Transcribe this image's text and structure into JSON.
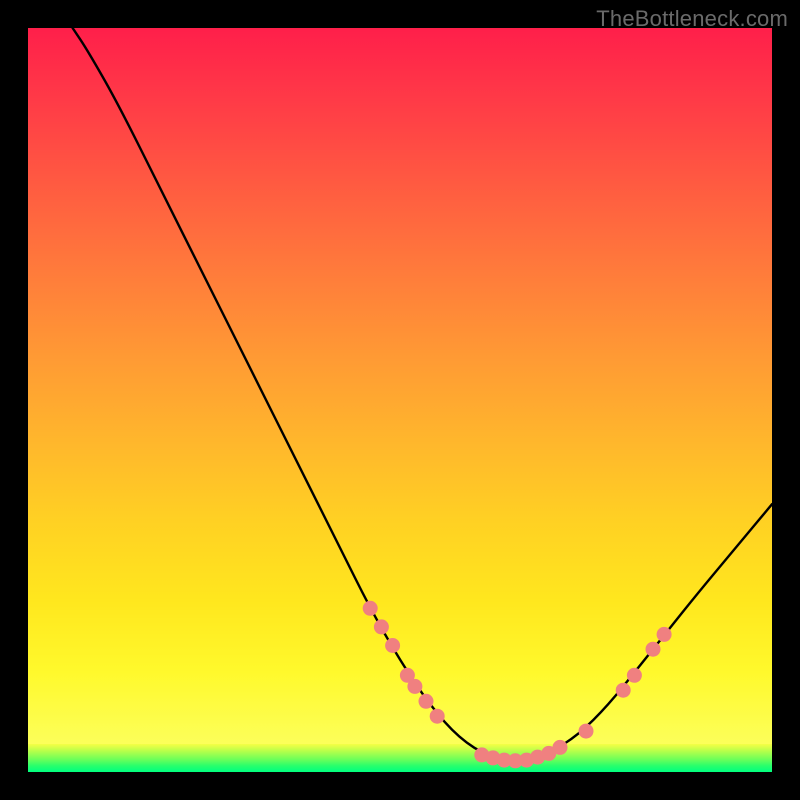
{
  "attribution": "TheBottleneck.com",
  "colors": {
    "point": "#f08080",
    "curve": "#000000",
    "gradient_top": "#ff1f4a",
    "gradient_mid": "#ffd123",
    "gradient_green": "#00ff80"
  },
  "chart_data": {
    "type": "line",
    "title": "",
    "xlabel": "",
    "ylabel": "",
    "xlim": [
      0,
      100
    ],
    "ylim": [
      0,
      100
    ],
    "grid": false,
    "legend": false,
    "note": "No axis tick labels are visible in the image; x and y are normalized 0–100 across the plot area. The black curve descends steeply from the top-left, bottoms out near x≈66, and rises toward the right edge. Salmon dots mark sampled points on the curve, clustered around the minimum.",
    "curve": [
      {
        "x": 6,
        "y": 100
      },
      {
        "x": 8,
        "y": 97
      },
      {
        "x": 12,
        "y": 90
      },
      {
        "x": 18,
        "y": 78
      },
      {
        "x": 24,
        "y": 66
      },
      {
        "x": 30,
        "y": 54
      },
      {
        "x": 36,
        "y": 42
      },
      {
        "x": 42,
        "y": 30
      },
      {
        "x": 46,
        "y": 22
      },
      {
        "x": 50,
        "y": 15
      },
      {
        "x": 54,
        "y": 9
      },
      {
        "x": 58,
        "y": 4.5
      },
      {
        "x": 62,
        "y": 2
      },
      {
        "x": 66,
        "y": 1.5
      },
      {
        "x": 70,
        "y": 2.5
      },
      {
        "x": 74,
        "y": 5
      },
      {
        "x": 78,
        "y": 9
      },
      {
        "x": 82,
        "y": 14
      },
      {
        "x": 86,
        "y": 19
      },
      {
        "x": 90,
        "y": 24
      },
      {
        "x": 95,
        "y": 30
      },
      {
        "x": 100,
        "y": 36
      }
    ],
    "points": [
      {
        "x": 46,
        "y": 22
      },
      {
        "x": 47.5,
        "y": 19.5
      },
      {
        "x": 49,
        "y": 17
      },
      {
        "x": 51,
        "y": 13
      },
      {
        "x": 52,
        "y": 11.5
      },
      {
        "x": 53.5,
        "y": 9.5
      },
      {
        "x": 55,
        "y": 7.5
      },
      {
        "x": 61,
        "y": 2.3
      },
      {
        "x": 62.5,
        "y": 1.9
      },
      {
        "x": 64,
        "y": 1.6
      },
      {
        "x": 65.5,
        "y": 1.5
      },
      {
        "x": 67,
        "y": 1.6
      },
      {
        "x": 68.5,
        "y": 2.0
      },
      {
        "x": 70,
        "y": 2.5
      },
      {
        "x": 71.5,
        "y": 3.3
      },
      {
        "x": 75,
        "y": 5.5
      },
      {
        "x": 80,
        "y": 11
      },
      {
        "x": 81.5,
        "y": 13
      },
      {
        "x": 84,
        "y": 16.5
      },
      {
        "x": 85.5,
        "y": 18.5
      }
    ]
  }
}
